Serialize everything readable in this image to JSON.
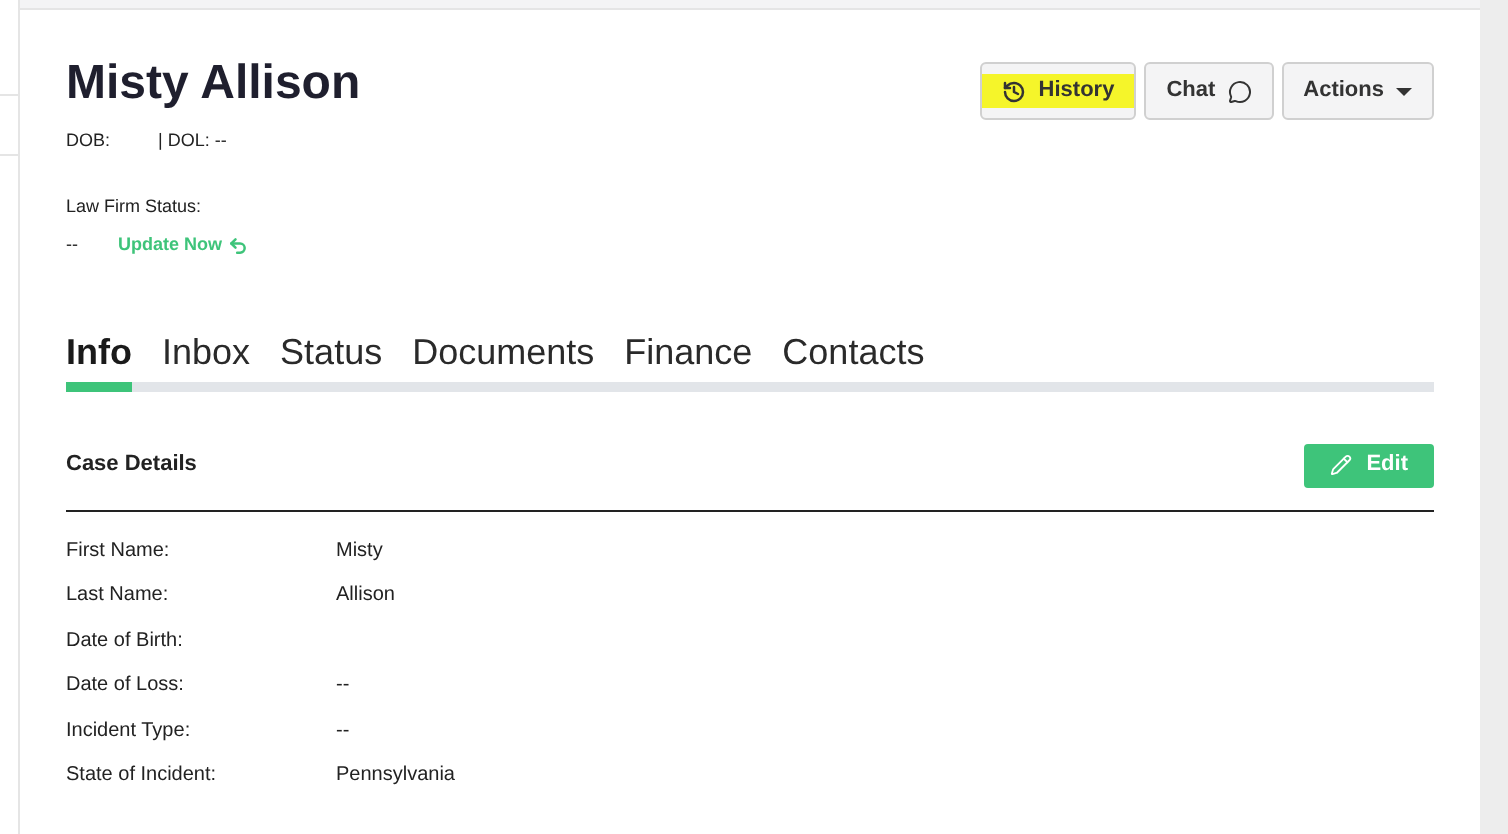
{
  "header": {
    "name": "Misty Allison",
    "dob_label": "DOB:",
    "dol": "| DOL: --",
    "law_firm_status_label": "Law Firm Status:",
    "law_firm_status": "--",
    "update_link": "Update Now"
  },
  "actions": [
    {
      "kind": "history",
      "label": "History",
      "highlighted": true
    },
    {
      "kind": "chat",
      "label": "Chat",
      "highlighted": false
    },
    {
      "kind": "dropdown",
      "label": "Actions",
      "highlighted": false
    }
  ],
  "tabs": [
    {
      "label": "Info",
      "selected": true
    },
    {
      "label": "Inbox",
      "selected": false
    },
    {
      "label": "Status",
      "selected": false
    },
    {
      "label": "Documents",
      "selected": false
    },
    {
      "label": "Finance",
      "selected": false
    },
    {
      "label": "Contacts",
      "selected": false
    }
  ],
  "section": {
    "title": "Case Details",
    "edit_button": "Edit"
  },
  "fields": [
    {
      "label": "First Name",
      "value": "Misty"
    },
    {
      "label": "Last Name",
      "value": "Allison"
    },
    {
      "label": "Date of Birth"
    },
    {
      "label": "Date of Loss",
      "value": "--"
    },
    {
      "label": "Incident Type",
      "value": "--"
    },
    {
      "label": "State of Incident",
      "value": "Pennsylvania"
    }
  ],
  "field_separator": ":"
}
